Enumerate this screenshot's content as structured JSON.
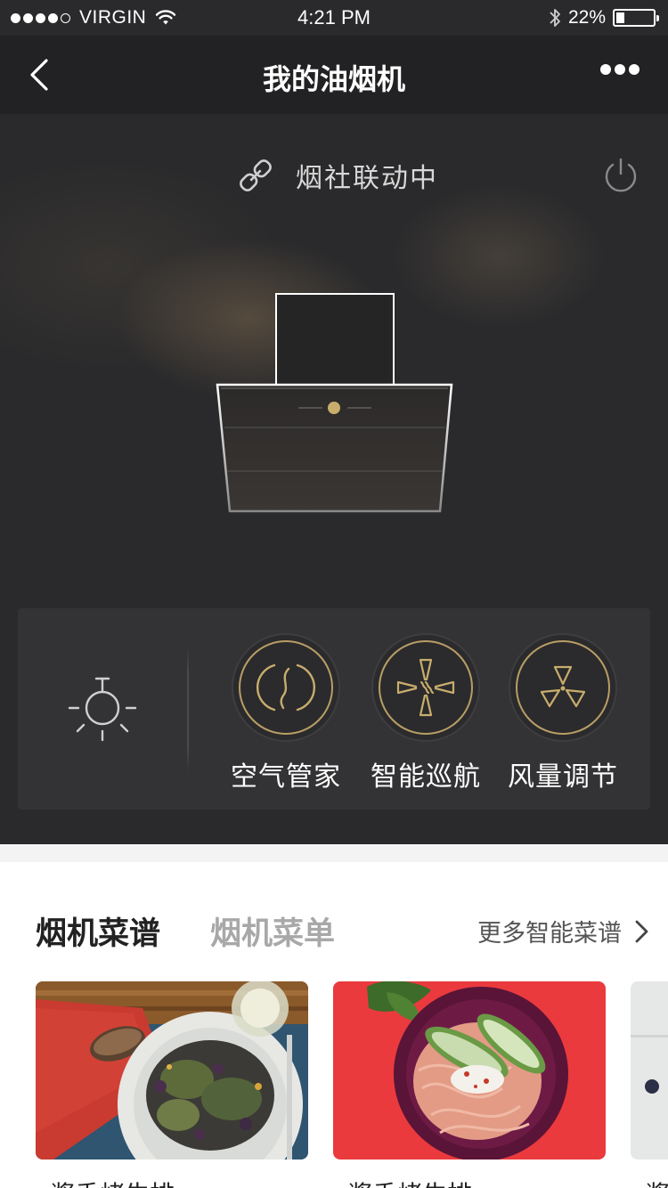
{
  "status_bar": {
    "carrier": "VIRGIN",
    "time": "4:21 PM",
    "battery_percent": "22%",
    "battery_level": 0.22,
    "signal_bars": 4,
    "signal_max": 5
  },
  "nav": {
    "title": "我的油烟机",
    "back_icon": "chevron-left-icon",
    "more_icon": "ellipsis-icon"
  },
  "device": {
    "link_status": "烟社联动中",
    "link_icon": "chain-link-icon",
    "power_icon": "power-icon",
    "accent_color": "#b89e64"
  },
  "controls": {
    "light_icon": "lamp-icon",
    "items": [
      {
        "label": "空气管家",
        "icon": "air-steward-icon"
      },
      {
        "label": "智能巡航",
        "icon": "smart-cruise-icon"
      },
      {
        "label": "风量调节",
        "icon": "fan-icon"
      }
    ]
  },
  "recipes": {
    "tabs": [
      {
        "label": "烟机菜谱",
        "active": true
      },
      {
        "label": "烟机菜单",
        "active": false
      }
    ],
    "more_label": "更多智能菜谱",
    "cards": [
      {
        "name": "酱香烤牛排"
      },
      {
        "name": "酱香烤牛排"
      },
      {
        "name": "酱"
      }
    ]
  }
}
